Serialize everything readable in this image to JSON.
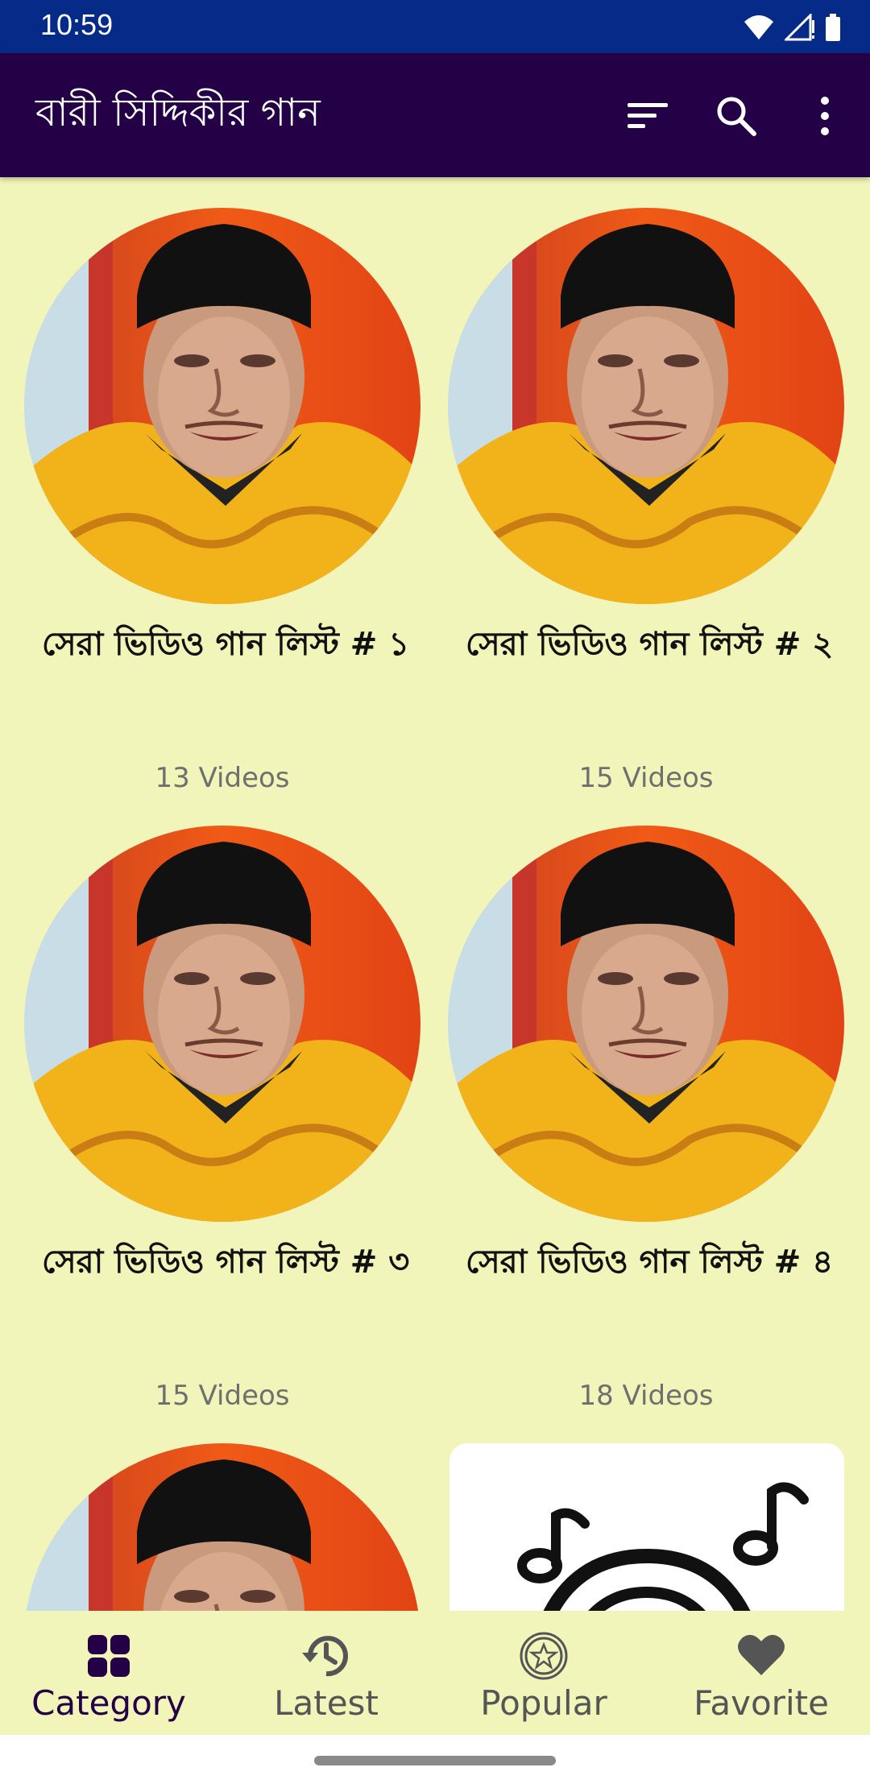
{
  "status_bar": {
    "time": "10:59",
    "icons": [
      "wifi-icon",
      "signal-icon",
      "battery-icon"
    ]
  },
  "app_bar": {
    "title": "বারী সিদ্দিকীর গান",
    "actions": [
      "sort-icon",
      "search-icon",
      "more-vert-icon"
    ],
    "background": "#240046"
  },
  "categories": [
    {
      "title": "সেরা ভিডিও গান লিস্ট # ১",
      "count": "13 Videos"
    },
    {
      "title": "সেরা ভিডিও গান লিস্ট # ২",
      "count": "15 Videos"
    },
    {
      "title": "সেরা ভিডিও গান লিস্ট # ৩",
      "count": "15 Videos"
    },
    {
      "title": "সেরা ভিডিও গান লিস্ট # ৪",
      "count": "18 Videos"
    }
  ],
  "bottom_nav": {
    "items": [
      {
        "label": "Category",
        "icon": "grid-icon",
        "active": true
      },
      {
        "label": "Latest",
        "icon": "history-icon",
        "active": false
      },
      {
        "label": "Popular",
        "icon": "star-badge-icon",
        "active": false
      },
      {
        "label": "Favorite",
        "icon": "heart-icon",
        "active": false
      }
    ]
  },
  "colors": {
    "background": "#f1f5b9",
    "status_bar": "#062a87",
    "accent": "#240046"
  }
}
